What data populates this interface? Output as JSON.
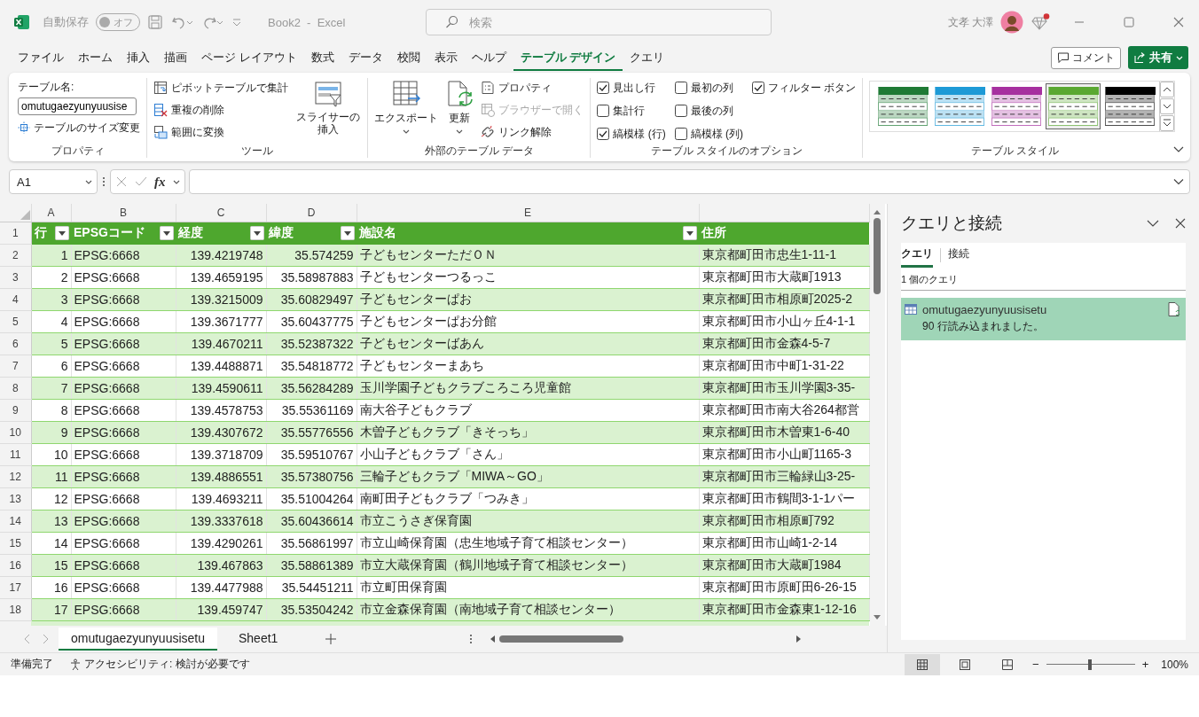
{
  "titlebar": {
    "autosave_label": "自動保存",
    "autosave": {
      "label": "オフ",
      "on": false
    },
    "title": "Book2  -  Excel",
    "search_placeholder": "検索",
    "user_name": "文孝 大澤"
  },
  "menu_tabs": [
    {
      "label": "ファイル",
      "selected": false
    },
    {
      "label": "ホーム",
      "selected": false
    },
    {
      "label": "挿入",
      "selected": false
    },
    {
      "label": "描画",
      "selected": false
    },
    {
      "label": "ページ レイアウト",
      "selected": false
    },
    {
      "label": "数式",
      "selected": false
    },
    {
      "label": "データ",
      "selected": false
    },
    {
      "label": "校閲",
      "selected": false
    },
    {
      "label": "表示",
      "selected": false
    },
    {
      "label": "ヘルプ",
      "selected": false
    },
    {
      "label": "テーブル デザイン",
      "selected": true
    },
    {
      "label": "クエリ",
      "selected": false
    }
  ],
  "header_buttons": {
    "comment": "コメント",
    "share": "共有"
  },
  "ribbon": {
    "properties": {
      "table_name_label": "テーブル名:",
      "table_name_value": "omutugaezyunyuusise",
      "resize": "テーブルのサイズ変更",
      "group_label": "プロパティ"
    },
    "tools": {
      "buttons": [
        "ピボットテーブルで集計",
        "重複の削除",
        "範囲に変換"
      ],
      "slicer": "スライサーの挿入",
      "group_label": "ツール"
    },
    "external": {
      "export": "エクスポート",
      "refresh": "更新",
      "items": [
        {
          "label": "プロパティ",
          "disabled": false
        },
        {
          "label": "ブラウザーで開く",
          "disabled": true
        },
        {
          "label": "リンク解除",
          "disabled": false
        }
      ],
      "group_label": "外部のテーブル データ"
    },
    "style_options": {
      "options": [
        {
          "label": "見出し行",
          "checked": true
        },
        {
          "label": "集計行",
          "checked": false
        },
        {
          "label": "縞模様 (行)",
          "checked": true
        },
        {
          "label": "最初の列",
          "checked": false
        },
        {
          "label": "最後の列",
          "checked": false
        },
        {
          "label": "縞模様 (列)",
          "checked": false
        },
        {
          "label": "フィルター ボタン",
          "checked": true
        }
      ],
      "group_label": "テーブル スタイルのオプション"
    },
    "table_styles": {
      "swatches": [
        {
          "color": "#1f7a35",
          "selected": false
        },
        {
          "color": "#1e9ad6",
          "selected": false
        },
        {
          "color": "#a6309f",
          "selected": false
        },
        {
          "color": "#5aa832",
          "selected": true
        },
        {
          "color": "#000000",
          "selected": false
        }
      ],
      "group_label": "テーブル スタイル"
    }
  },
  "formula_bar": {
    "name_box": "A1",
    "fx": "fx"
  },
  "grid": {
    "column_letters": [
      "A",
      "B",
      "C",
      "D",
      "E"
    ],
    "table_header": {
      "row_number": "1",
      "cells": [
        "行",
        "EPSGコード",
        "経度",
        "緯度",
        "施設名",
        "住所"
      ]
    },
    "rows": [
      {
        "row_number": "2",
        "cells": [
          "1",
          "EPSG:6668",
          "139.4219748",
          "35.574259",
          "子どもセンターただＯＮ",
          "東京都町田市忠生1-11-1"
        ]
      },
      {
        "row_number": "3",
        "cells": [
          "2",
          "EPSG:6668",
          "139.4659195",
          "35.58987883",
          "子どもセンターつるっこ",
          "東京都町田市大蔵町1913"
        ]
      },
      {
        "row_number": "4",
        "cells": [
          "3",
          "EPSG:6668",
          "139.3215009",
          "35.60829497",
          "子どもセンターぱお",
          "東京都町田市相原町2025-2"
        ]
      },
      {
        "row_number": "5",
        "cells": [
          "4",
          "EPSG:6668",
          "139.3671777",
          "35.60437775",
          "子どもセンターぱお分館",
          "東京都町田市小山ヶ丘4-1-1"
        ]
      },
      {
        "row_number": "6",
        "cells": [
          "5",
          "EPSG:6668",
          "139.4670211",
          "35.52387322",
          "子どもセンターばあん",
          "東京都町田市金森4-5-7"
        ]
      },
      {
        "row_number": "7",
        "cells": [
          "6",
          "EPSG:6668",
          "139.4488871",
          "35.54818772",
          "子どもセンターまあち",
          "東京都町田市中町1-31-22"
        ]
      },
      {
        "row_number": "8",
        "cells": [
          "7",
          "EPSG:6668",
          "139.4590611",
          "35.56284289",
          "玉川学園子どもクラブころころ児童館",
          "東京都町田市玉川学園3-35-"
        ]
      },
      {
        "row_number": "9",
        "cells": [
          "8",
          "EPSG:6668",
          "139.4578753",
          "35.55361169",
          "南大谷子どもクラブ",
          "東京都町田市南大谷264都営"
        ]
      },
      {
        "row_number": "10",
        "cells": [
          "9",
          "EPSG:6668",
          "139.4307672",
          "35.55776556",
          "木曽子どもクラブ「きそっち」",
          "東京都町田市木曽東1-6-40"
        ]
      },
      {
        "row_number": "11",
        "cells": [
          "10",
          "EPSG:6668",
          "139.3718709",
          "35.59510767",
          "小山子どもクラブ「さん」",
          "東京都町田市小山町1165-3"
        ]
      },
      {
        "row_number": "12",
        "cells": [
          "11",
          "EPSG:6668",
          "139.4886551",
          "35.57380756",
          "三輪子どもクラブ「MIWA～GO」",
          "東京都町田市三輪緑山3-25-"
        ]
      },
      {
        "row_number": "13",
        "cells": [
          "12",
          "EPSG:6668",
          "139.4693211",
          "35.51004264",
          "南町田子どもクラブ「つみき」",
          "東京都町田市鶴間3-1-1パー"
        ]
      },
      {
        "row_number": "14",
        "cells": [
          "13",
          "EPSG:6668",
          "139.3337618",
          "35.60436614",
          "市立こうさぎ保育園",
          "東京都町田市相原町792"
        ]
      },
      {
        "row_number": "15",
        "cells": [
          "14",
          "EPSG:6668",
          "139.4290261",
          "35.56861997",
          "市立山崎保育園（忠生地域子育て相談センター）",
          "東京都町田市山崎1-2-14"
        ]
      },
      {
        "row_number": "16",
        "cells": [
          "15",
          "EPSG:6668",
          "139.467863",
          "35.58861389",
          "市立大蔵保育園（鶴川地域子育て相談センター）",
          "東京都町田市大蔵町1984"
        ]
      },
      {
        "row_number": "17",
        "cells": [
          "16",
          "EPSG:6668",
          "139.4477988",
          "35.54451211",
          "市立町田保育園",
          "東京都町田市原町田6-26-15"
        ]
      },
      {
        "row_number": "18",
        "cells": [
          "17",
          "EPSG:6668",
          "139.459747",
          "35.53504242",
          "市立金森保育園（南地域子育て相談センター）",
          "東京都町田市金森東1-12-16"
        ]
      }
    ]
  },
  "query_pane": {
    "title": "クエリと接続",
    "tabs": [
      {
        "label": "クエリ",
        "selected": true
      },
      {
        "label": "接続",
        "selected": false
      }
    ],
    "count": "1 個のクエリ",
    "queries": [
      {
        "name": "omutugaezyunyuusisetu",
        "status": "90 行読み込まれました。",
        "selected": true
      }
    ]
  },
  "sheet_tabs": [
    {
      "label": "omutugaezyunyuusisetu",
      "selected": true
    },
    {
      "label": "Sheet1",
      "selected": false
    }
  ],
  "status_bar": {
    "ready": "準備完了",
    "accessibility": "アクセシビリティ: 検討が必要です",
    "views": [
      {
        "kind": "normal",
        "selected": true
      },
      {
        "kind": "page_layout",
        "selected": false
      },
      {
        "kind": "page_break",
        "selected": false
      }
    ],
    "zoom_out": "−",
    "zoom_in": "+",
    "zoom": {
      "level": 0.49
    },
    "zoom_label": "100%"
  }
}
